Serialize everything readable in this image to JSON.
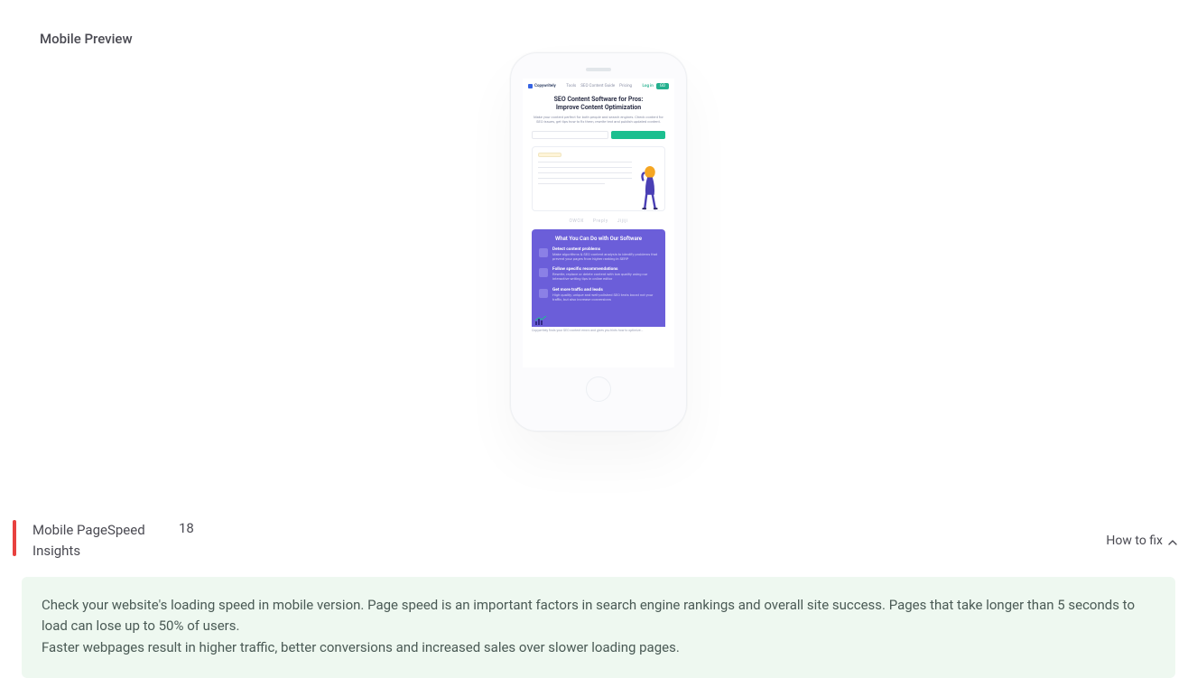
{
  "preview": {
    "title": "Mobile Preview",
    "site": {
      "brand": "Copywritely",
      "nav": [
        "Tools",
        "SEO Content Guide",
        "Pricing"
      ],
      "login": "Log in",
      "cta": "GO",
      "hero_title_l1": "SEO Content Software for Pros:",
      "hero_title_l2": "Improve Content Optimization",
      "hero_sub": "Make your content perfect for both people and search engines. Check content for SEO issues, get tips how to fix them, rewrite text and publish updated content.",
      "logos": [
        "OWOX",
        "Preply",
        "Jijiji"
      ],
      "panel_title": "What You Can Do with Our Software",
      "items": [
        {
          "t": "Detect content problems",
          "s": "Make algorithms & SEO content analysis to identify problems that prevent your pages from higher ranking in SERP"
        },
        {
          "t": "Follow specific recommendations",
          "s": "Rewrite, replace or delete content with low quality using our interactive writing tips in online editor"
        },
        {
          "t": "Get more traffic and leads",
          "s": "High quality, unique and well-polished SEO texts boost not your traffic, but also increase conversions"
        }
      ]
    }
  },
  "pagespeed": {
    "label": "Mobile PageSpeed Insights",
    "score": "18",
    "how_to_fix": "How to fix",
    "tip_p1": "Check your website's loading speed in mobile version. Page speed is an important factors in search engine rankings and overall site success. Pages that take longer than 5 seconds to load can lose up to 50% of users.",
    "tip_p2": "Faster webpages result in higher traffic, better conversions and increased sales over slower loading pages."
  }
}
